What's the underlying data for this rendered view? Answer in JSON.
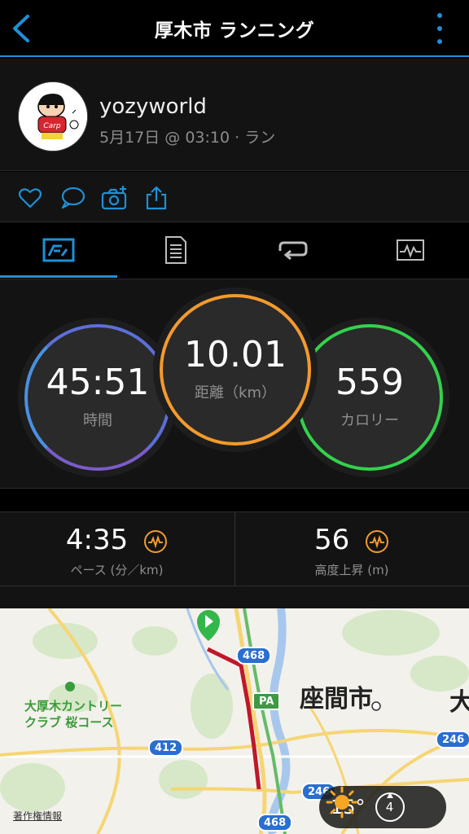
{
  "header": {
    "title": "厚木市 ランニング"
  },
  "profile": {
    "username": "yozyworld",
    "subtitle": "5月17日 @ 03:10 · ラン"
  },
  "stats": {
    "time": {
      "value": "45:51",
      "label": "時間"
    },
    "distance": {
      "value": "10.01",
      "label": "距離（km）"
    },
    "calories": {
      "value": "559",
      "label": "カロリー"
    }
  },
  "metrics": {
    "pace": {
      "value": "4:35",
      "label": "ペース (分／km)"
    },
    "elevation": {
      "value": "56",
      "label": "高度上昇 (m)"
    }
  },
  "map": {
    "city_label": "座間市",
    "city_label_partial": "大",
    "golf_label_line1": "大厚木カントリー",
    "golf_label_line2": "クラブ 桜コース",
    "route_468_top": "468",
    "route_412": "412",
    "route_246": "246",
    "route_246_partial": "246",
    "route_468_bottom": "468",
    "pa_label": "PA",
    "copyright": "著作権情報",
    "weather_temp": "15°",
    "wind_value": "4"
  },
  "colors": {
    "accent": "#1f8fd6",
    "distance_ring": "#f29a2e",
    "calorie_ring": "#33d24d",
    "time_ring": "#5b6fd6",
    "route_line": "#c0182b"
  }
}
